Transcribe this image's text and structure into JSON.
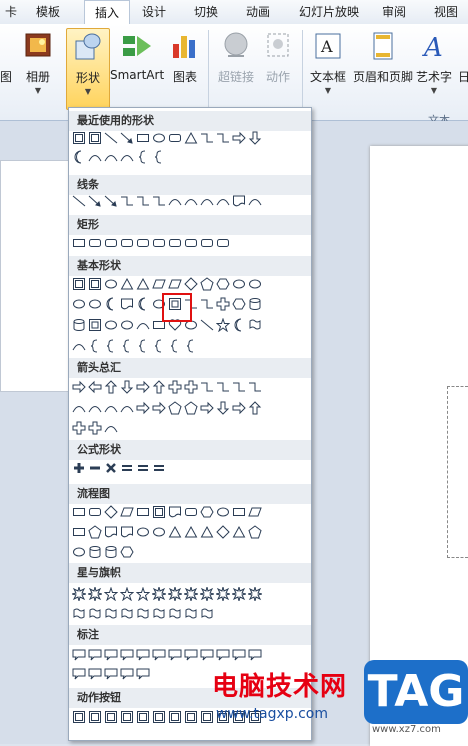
{
  "tabs": [
    "卡",
    "模板",
    "插入",
    "设计",
    "切换",
    "动画",
    "幻灯片放映",
    "审阅",
    "视图"
  ],
  "ribbon": {
    "buttons": [
      "图",
      "相册",
      "形状",
      "SmartArt",
      "图表",
      "超链接",
      "动作",
      "文本框",
      "页眉和页脚",
      "艺术字",
      "日"
    ],
    "group_label": "文本"
  },
  "menu": {
    "sections": [
      "最近使用的形状",
      "线条",
      "矩形",
      "基本形状",
      "箭头总汇",
      "公式形状",
      "流程图",
      "星与旗帜",
      "标注",
      "动作按钮"
    ]
  },
  "watermark": {
    "brand": "电脑技术网",
    "url": "www.tagxp.com",
    "logo": "TAG",
    "url2": "www.xz7.com"
  },
  "colors": {
    "selected_button": "#ffd35c",
    "highlight_box": "#e01010"
  }
}
